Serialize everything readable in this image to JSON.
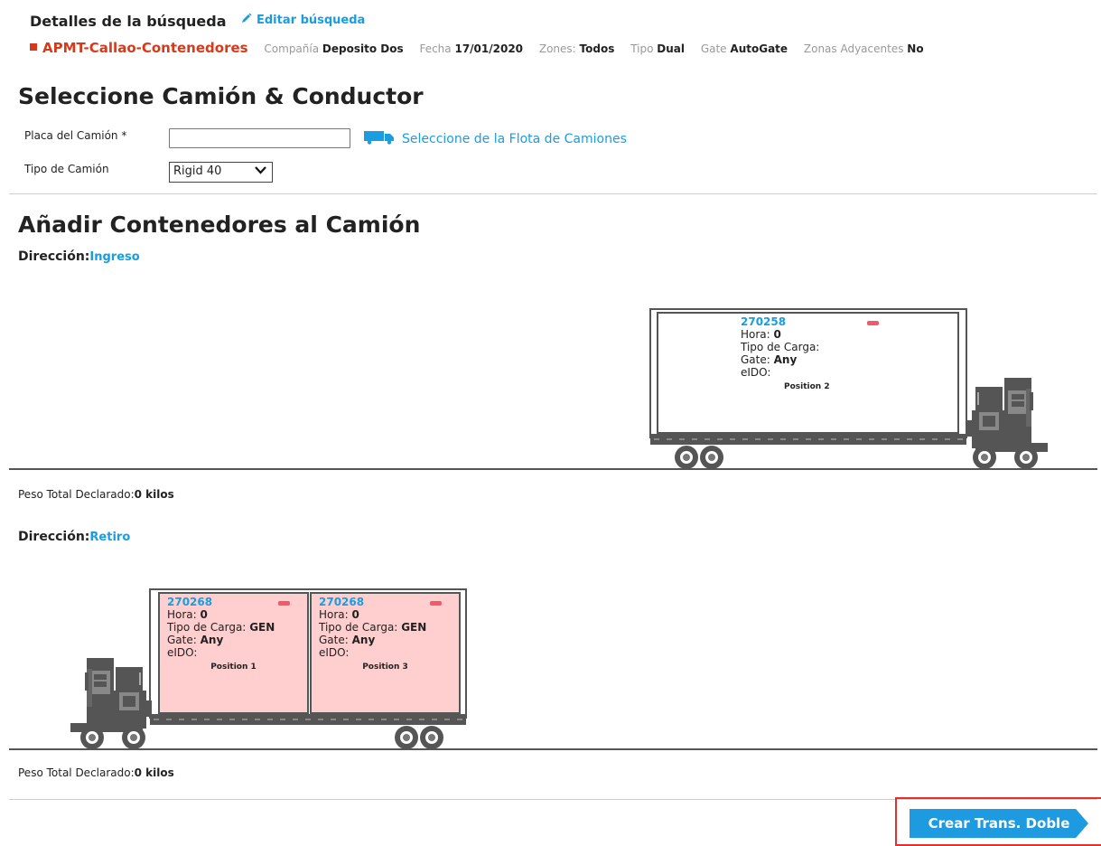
{
  "header": {
    "title": "Detalles de la búsqueda",
    "edit_link": "Editar búsqueda",
    "terminal": "APMT-Callao-Contenedores",
    "fields": [
      {
        "key": "Compañía",
        "value": "Deposito Dos"
      },
      {
        "key": "Fecha",
        "value": "17/01/2020"
      },
      {
        "key": "Zones:",
        "value": "Todos"
      },
      {
        "key": "Tipo",
        "value": "Dual"
      },
      {
        "key": "Gate",
        "value": "AutoGate"
      },
      {
        "key": "Zonas Adyacentes",
        "value": "No"
      }
    ]
  },
  "truck_section": {
    "title": "Seleccione Camión & Conductor",
    "placa_label": "Placa del Camión *",
    "placa_value": "",
    "fleet_link": "Seleccione de la Flota de Camiones",
    "tipo_label": "Tipo de Camión",
    "tipo_value": "Rigid 40"
  },
  "containers_section": {
    "title": "Añadir Contenedores al Camión",
    "direction_label": "Dirección:",
    "ingreso": {
      "direction": "Ingreso",
      "containers": [
        {
          "id": "270258",
          "hora_label": "Hora:",
          "hora": "0",
          "tipo_label": "Tipo de Carga:",
          "tipo": "",
          "gate_label": "Gate:",
          "gate": "Any",
          "eido_label": "eIDO:",
          "position": "Position 2"
        }
      ],
      "peso_label": "Peso Total Declarado:",
      "peso_value": "0 kilos"
    },
    "retiro": {
      "direction": "Retiro",
      "containers": [
        {
          "id": "270268",
          "hora_label": "Hora:",
          "hora": "0",
          "tipo_label": "Tipo de Carga:",
          "tipo": "GEN",
          "gate_label": "Gate:",
          "gate": "Any",
          "eido_label": "eIDO:",
          "position": "Position 1"
        },
        {
          "id": "270268",
          "hora_label": "Hora:",
          "hora": "0",
          "tipo_label": "Tipo de Carga:",
          "tipo": "GEN",
          "gate_label": "Gate:",
          "gate": "Any",
          "eido_label": "eIDO:",
          "position": "Position 3"
        }
      ],
      "peso_label": "Peso Total Declarado:",
      "peso_value": "0 kilos"
    }
  },
  "actions": {
    "crear_label": "Crear Trans. Doble"
  },
  "colors": {
    "accent": "#1a9de0",
    "terminal": "#d63a1a",
    "container_filled": "#ffcfcf",
    "remove": "#f05a6a",
    "highlight": "#e03030"
  },
  "icons": [
    "pencil-icon",
    "truck-icon",
    "remove-icon",
    "chevron-down-icon"
  ]
}
